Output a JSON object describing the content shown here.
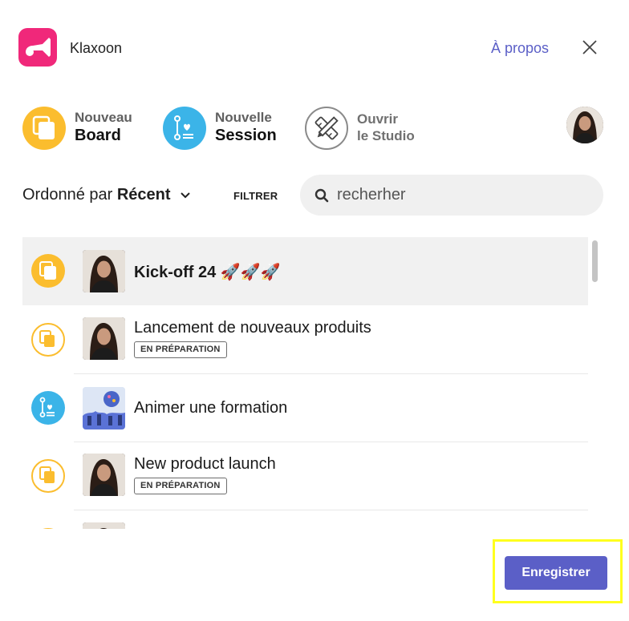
{
  "header": {
    "app_name": "Klaxoon",
    "about_label": "À propos",
    "close_icon": "close-icon"
  },
  "actions": [
    {
      "line1": "Nouveau",
      "line2": "Board",
      "icon": "board-icon",
      "color": "#fbbd2e"
    },
    {
      "line1": "Nouvelle",
      "line2": "Session",
      "icon": "session-icon",
      "color": "#3bb4e8"
    },
    {
      "line1": "Ouvrir",
      "line2": "le Studio",
      "icon": "studio-tools-icon",
      "color": "#8a8a8a"
    }
  ],
  "toolbar": {
    "sort_prefix": "Ordonné par",
    "sort_value": "Récent",
    "filter_label": "FILTRER",
    "search_placeholder": "recherher"
  },
  "list": {
    "items": [
      {
        "title": "Kick-off 24 🚀🚀🚀",
        "type": "board",
        "badge": null,
        "selected": true
      },
      {
        "title": "Lancement de nouveaux produits",
        "type": "board",
        "badge": "EN PRÉPARATION",
        "selected": false
      },
      {
        "title": "Animer une formation",
        "type": "session",
        "badge": null,
        "selected": false
      },
      {
        "title": "New product launch",
        "type": "board",
        "badge": "EN PRÉPARATION",
        "selected": false
      },
      {
        "title": "",
        "type": "board",
        "badge": null,
        "selected": false
      }
    ]
  },
  "footer": {
    "save_label": "Enregistrer"
  },
  "colors": {
    "brand": "#f0287a",
    "accent": "#5b5fc7",
    "board": "#fbbd2e",
    "session": "#3bb4e8",
    "highlight": "#ffff1e"
  }
}
